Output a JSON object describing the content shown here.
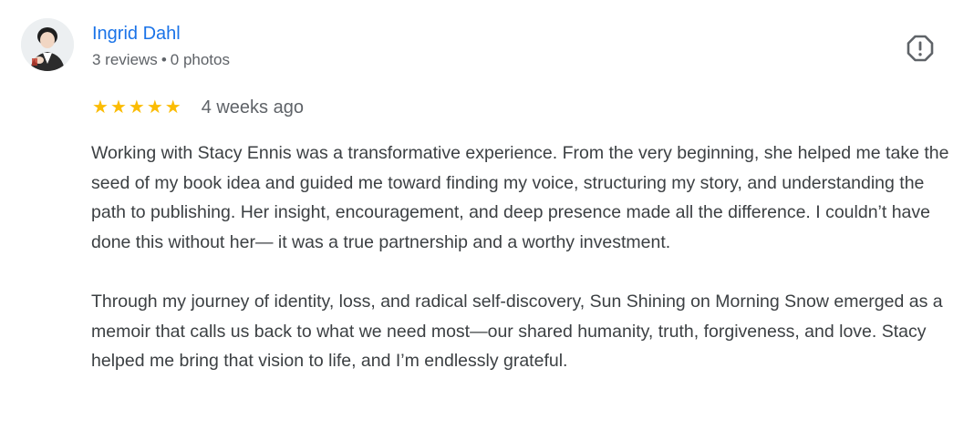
{
  "review": {
    "author": {
      "name": "Ingrid Dahl",
      "reviews": "3 reviews",
      "separator": "•",
      "photos": "0 photos"
    },
    "rating": {
      "stars": 5,
      "max_stars": 5,
      "star_glyph": "★"
    },
    "date": "4 weeks ago",
    "report_icon": "report-flag-icon",
    "paragraphs": [
      "Working with Stacy Ennis was a transformative experience. From the very beginning, she helped me take the seed of my book idea and guided me toward finding my voice, structuring my story, and understanding the path to publishing. Her insight, encouragement, and deep presence made all the difference. I couldn’t have done this without her— it was a true partnership and a worthy investment.",
      "Through my journey of identity, loss, and radical self-discovery, Sun Shining on Morning Snow emerged as a memoir that calls us back to what we need most—our shared humanity, truth, forgiveness, and love. Stacy helped me bring that vision to life, and I’m endlessly grateful."
    ]
  },
  "colors": {
    "author_link": "#1a73e8",
    "star": "#fbbc04",
    "secondary_text": "#5f6368",
    "body_text": "#3c4043",
    "icon": "#5f6368"
  }
}
